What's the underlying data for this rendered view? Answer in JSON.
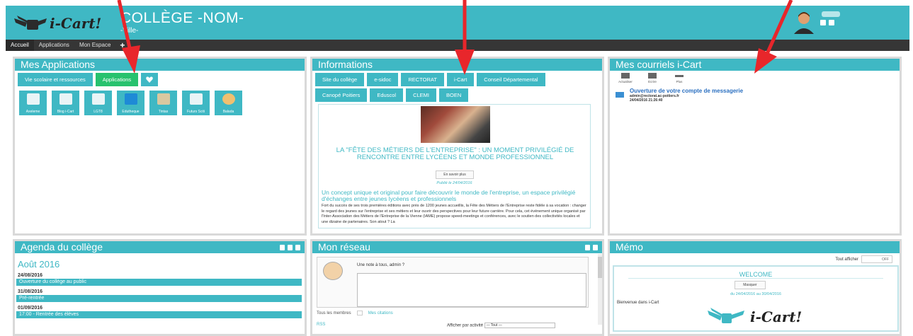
{
  "header": {
    "logo_text": "i-Cart!",
    "school_title": "COLLÈGE -NOM-",
    "school_city": "-Ville-"
  },
  "nav": {
    "items": [
      "Accueil",
      "Applications",
      "Mon Espace"
    ],
    "plus": "+"
  },
  "mes_applications": {
    "title": "Mes Applications",
    "tabs": [
      "Vie scolaire et ressources",
      "Applications"
    ],
    "dropdown_icon": "heart-icon",
    "apps": [
      {
        "label": "Axeleme",
        "icon": "globe-icon"
      },
      {
        "label": "Blog i-Cart",
        "icon": "mail-icon"
      },
      {
        "label": "LGT8",
        "icon": "chart-icon"
      },
      {
        "label": "Edutheque",
        "icon": "e-icon"
      },
      {
        "label": "Tintas",
        "icon": "book-icon"
      },
      {
        "label": "Futurs Sciti",
        "icon": "sos-icon"
      },
      {
        "label": "Balada",
        "icon": "compass-icon"
      }
    ]
  },
  "informations": {
    "title": "Informations",
    "tabs_row1": [
      "Site du collège",
      "e-sidoc",
      "RECTORAT",
      "i-Cart",
      "Conseil Départemental"
    ],
    "tabs_row2": [
      "Canopé Poitiers",
      "Eduscol",
      "CLEMI",
      "BOEN"
    ],
    "article_title": "LA \"FÊTE DES MÉTIERS DE L'ENTREPRISE\" : UN MOMENT PRIVILÉGIÉ DE RENCONTRE ENTRE LYCÉENS ET MONDE PROFESSIONNEL",
    "read_more": "En savoir plus",
    "published": "Publié le 24/04/2016",
    "subtitle": "Un concept unique et original pour faire découvrir le monde de l'entreprise, un espace privilégié d'échanges entre jeunes lycéens et professionnels",
    "body": "Fort du succès de ses trois premières éditions avec près de 1200 jeunes accueillis, la Fête des Métiers de l'Entreprise reste fidèle à sa vocation : changer le regard des jeunes sur l'entreprise et ses métiers et leur ouvrir des perspectives pour leur future carrière. Pour cela, cet événement unique organisé par l'Inter-Association des Métiers de l'Entreprise de la Vienne (IAME) propose speed-meetings et conférences, avec le soutien des collectivités locales et une dizaine de partenaires. Son atout ? La"
  },
  "courriels": {
    "title": "Mes courriels i-Cart",
    "actions": [
      "Actualiser",
      "Ecrire",
      "Plus"
    ],
    "message": {
      "subject": "Ouverture de votre compte de messagerie",
      "from": "admin@rectorat.ac-poitiers.fr",
      "date": "24/04/2016 21:26:40"
    }
  },
  "agenda": {
    "title": "Agenda du collège",
    "month": "Août 2016",
    "events": [
      {
        "date": "24/08/2016",
        "label": "Ouverture du collège au public"
      },
      {
        "date": "31/08/2016",
        "label": "Pré-rentrée"
      },
      {
        "date": "01/09/2016",
        "label": "17:00 - Rentrée des élèves"
      }
    ]
  },
  "reseau": {
    "title": "Mon réseau",
    "prompt": "Une note à tous, admin ?",
    "members_label": "Tous les membres",
    "citations_label": "Mes citations",
    "rss": "RSS",
    "filter_label": "Afficher par activité",
    "filter_value": "— Tout —"
  },
  "memo": {
    "title": "Mémo",
    "show_all_label": "Tout afficher",
    "toggle_value": "OFF",
    "card_title": "WELCOME",
    "hide_btn": "Masquer",
    "date_range": "du 24/04/2016 au 30/04/2016",
    "body": "Bienvenue dans i-Cart",
    "logo_text": "i-Cart!"
  },
  "colors": {
    "accent": "#3fb8c4",
    "active_tab": "#27c26e",
    "nav_bg": "#363636",
    "arrow": "#e8262b"
  }
}
